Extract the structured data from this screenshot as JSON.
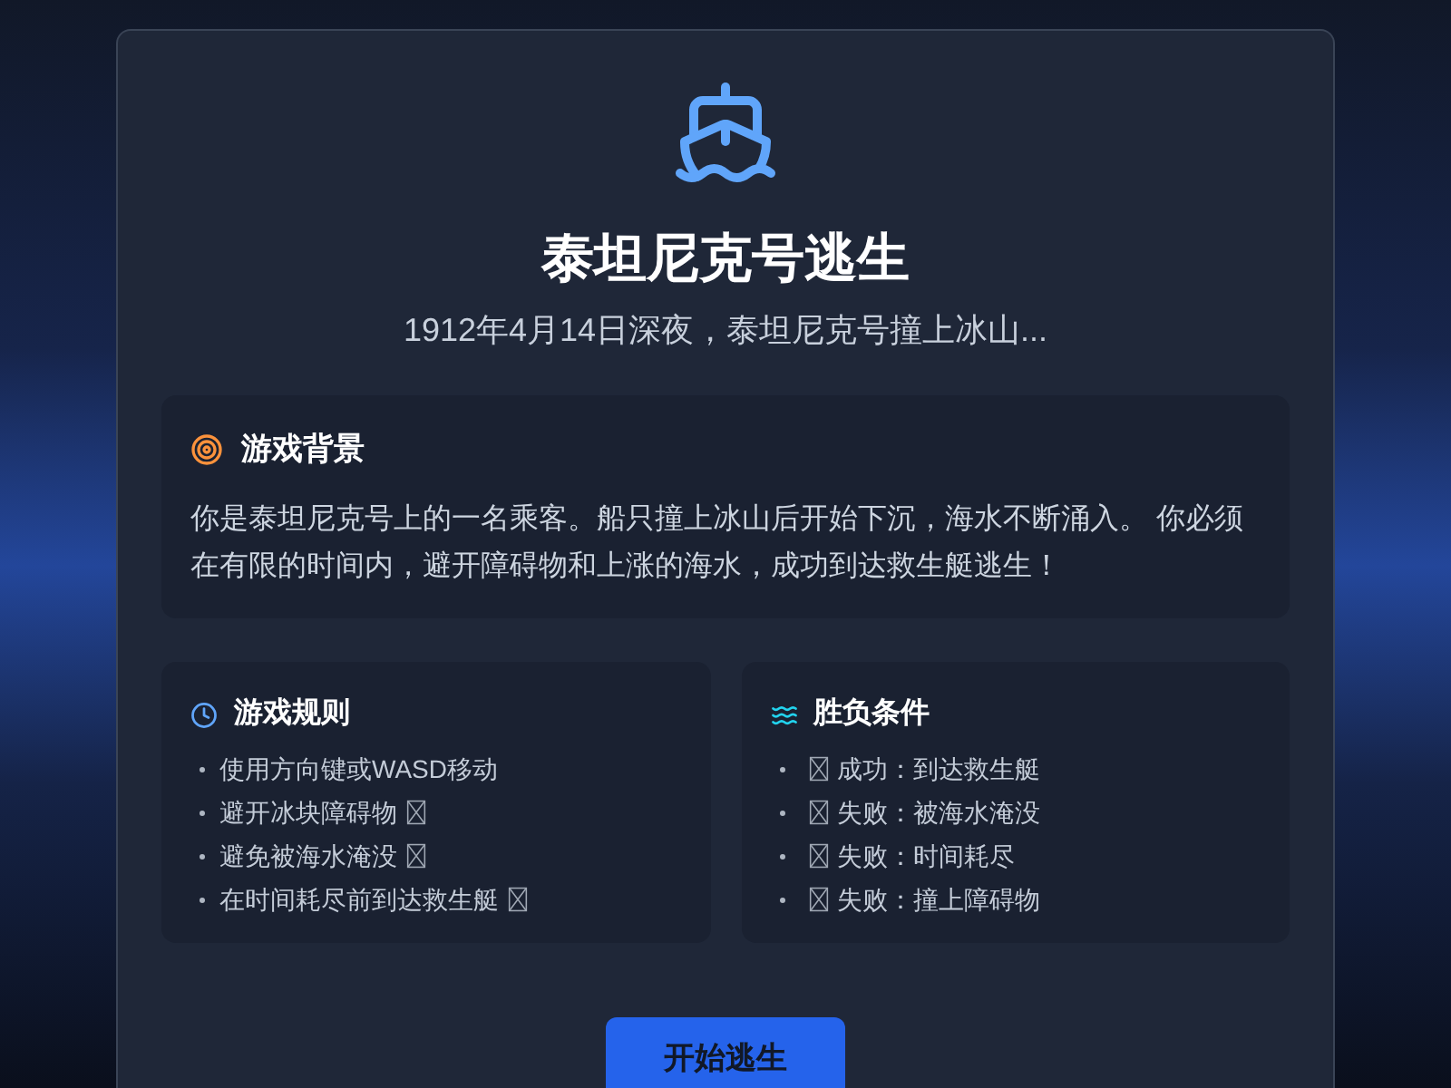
{
  "header": {
    "title": "泰坦尼克号逃生",
    "subtitle": "1912年4月14日深夜，泰坦尼克号撞上冰山..."
  },
  "background": {
    "heading": "游戏背景",
    "text": "你是泰坦尼克号上的一名乘客。船只撞上冰山后开始下沉，海水不断涌入。 你必须在有限的时间内，避开障碍物和上涨的海水，成功到达救生艇逃生！"
  },
  "panels": [
    {
      "kind": "rules",
      "heading": "游戏规则",
      "items": [
        {
          "text": "使用方向键或WASD移动",
          "box_after": false
        },
        {
          "text": "避开冰块障碍物",
          "box_after": true
        },
        {
          "text": "避免被海水淹没",
          "box_after": true
        },
        {
          "text": "在时间耗尽前到达救生艇",
          "box_after": true
        }
      ]
    },
    {
      "kind": "conditions",
      "heading": "胜负条件",
      "items": [
        {
          "text": "成功：到达救生艇",
          "box_before": true
        },
        {
          "text": "失败：被海水淹没",
          "box_before": true
        },
        {
          "text": "失败：时间耗尽",
          "box_before": true
        },
        {
          "text": "失败：撞上障碍物",
          "box_before": true
        }
      ]
    }
  ],
  "start_button": {
    "label": "开始逃生"
  }
}
